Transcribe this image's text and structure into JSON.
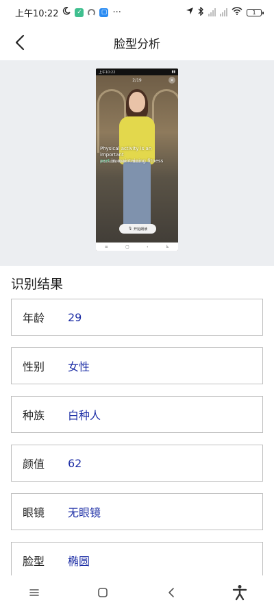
{
  "status_bar": {
    "time": "上午10:22",
    "battery": "1"
  },
  "header": {
    "title": "脸型分析"
  },
  "preview": {
    "top_time": "上午10:22",
    "counter": "2/19",
    "caption_line1": "Physical activity is an important",
    "caption_highlight": "part",
    "caption_line2": "in maintaining fitness",
    "subtitle": "体育活动是保持健康的一个重要部分",
    "record_label": "开始朗读"
  },
  "results": {
    "title": "识别结果",
    "items": [
      {
        "label": "年龄",
        "value": "29"
      },
      {
        "label": "性别",
        "value": "女性"
      },
      {
        "label": "种族",
        "value": "白种人"
      },
      {
        "label": "颜值",
        "value": "62"
      },
      {
        "label": "眼镜",
        "value": "无眼镜"
      },
      {
        "label": "脸型",
        "value": "椭圆"
      }
    ]
  },
  "colors": {
    "value_text": "#1e2fa6",
    "preview_bg": "#eceef1",
    "card_border": "#bdbdbd"
  }
}
